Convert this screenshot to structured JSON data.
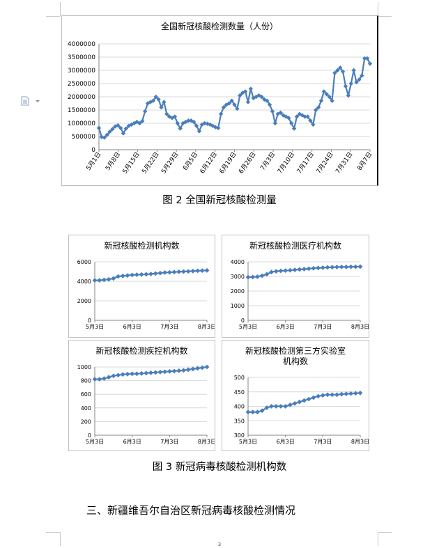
{
  "figure2": {
    "caption": "图 2 全国新冠核酸检测量",
    "chart_data": {
      "type": "line",
      "title": "全国新冠核酸检测数量（人份）",
      "x_tick_labels": [
        "5月1日",
        "5月8日",
        "5月15日",
        "5月22日",
        "5月29日",
        "6月5日",
        "6月12日",
        "6月19日",
        "6月26日",
        "7月3日",
        "7月10日",
        "7月17日",
        "7月24日",
        "7月31日",
        "8月7日"
      ],
      "ylim": [
        0,
        4000000
      ],
      "y_ticks": [
        0,
        500000,
        1000000,
        1500000,
        2000000,
        2500000,
        3000000,
        3500000,
        4000000
      ],
      "color": "#4a7ebb",
      "series": [
        {
          "values": [
            820000,
            480000,
            460000,
            560000,
            680000,
            780000,
            880000,
            920000,
            820000,
            620000,
            800000,
            900000,
            950000,
            1000000,
            1050000,
            1000000,
            1080000,
            1450000,
            1750000,
            1800000,
            1850000,
            2000000,
            1900000,
            1600000,
            1800000,
            1350000,
            1250000,
            1200000,
            1250000,
            1000000,
            800000,
            1000000,
            1050000,
            1100000,
            1100000,
            1050000,
            900000,
            700000,
            950000,
            1000000,
            980000,
            950000,
            900000,
            850000,
            820000,
            1350000,
            1600000,
            1700000,
            1750000,
            1850000,
            1700000,
            1550000,
            2050000,
            2150000,
            2200000,
            1800000,
            2300000,
            1950000,
            2000000,
            2050000,
            2000000,
            1900000,
            1850000,
            1700000,
            1450000,
            1000000,
            1350000,
            1400000,
            1300000,
            1250000,
            1200000,
            1000000,
            800000,
            1250000,
            1350000,
            1300000,
            1250000,
            1250000,
            1100000,
            950000,
            1500000,
            1600000,
            1850000,
            2200000,
            2100000,
            2000000,
            1850000,
            2900000,
            3000000,
            3100000,
            2950000,
            2400000,
            2050000,
            2500000,
            3000000,
            2550000,
            2650000,
            2800000,
            3450000,
            3450000,
            3250000
          ]
        }
      ]
    }
  },
  "figure3": {
    "caption": "图 3 新冠病毒核酸检测机构数",
    "x_tick_labels": [
      "5月3日",
      "6月3日",
      "7月3日",
      "8月3日"
    ],
    "charts": [
      {
        "type": "line",
        "title": "新冠核酸检测机构数",
        "ylim": [
          0,
          6000
        ],
        "y_ticks": [
          0,
          2000,
          4000,
          6000
        ],
        "series": [
          {
            "values": [
              4100,
              4100,
              4150,
              4200,
              4300,
              4500,
              4550,
              4600,
              4650,
              4680,
              4700,
              4720,
              4750,
              4800,
              4850,
              4900,
              4920,
              4950,
              4980,
              5000,
              5020,
              5050,
              5080,
              5100,
              5120
            ]
          }
        ]
      },
      {
        "type": "line",
        "title": "新冠核酸检测医疗机构数",
        "ylim": [
          0,
          4000
        ],
        "y_ticks": [
          0,
          1000,
          2000,
          3000,
          4000
        ],
        "series": [
          {
            "values": [
              2950,
              2960,
              2980,
              3050,
              3150,
              3300,
              3350,
              3380,
              3400,
              3420,
              3450,
              3480,
              3500,
              3530,
              3560,
              3580,
              3600,
              3620,
              3630,
              3640,
              3650,
              3650,
              3660,
              3660,
              3670
            ]
          }
        ]
      },
      {
        "type": "line",
        "title": "新冠核酸检测疾控机构数",
        "ylim": [
          0,
          1000
        ],
        "y_ticks": [
          0,
          200,
          400,
          600,
          800,
          1000
        ],
        "series": [
          {
            "values": [
              820,
              820,
              830,
              850,
              870,
              880,
              890,
              895,
              900,
              900,
              905,
              910,
              915,
              920,
              925,
              930,
              935,
              940,
              945,
              950,
              960,
              970,
              980,
              990,
              1000
            ]
          }
        ]
      },
      {
        "type": "line",
        "title": "新冠核酸检测第三方实验室机构数",
        "title_lines": [
          "新冠核酸检测第三方实验室",
          "机构数"
        ],
        "ylim": [
          300,
          500
        ],
        "y_ticks": [
          300,
          350,
          400,
          450,
          500
        ],
        "series": [
          {
            "values": [
              380,
              380,
              380,
              385,
              395,
              400,
              400,
              400,
              400,
              405,
              410,
              415,
              420,
              425,
              430,
              435,
              438,
              440,
              440,
              440,
              442,
              443,
              444,
              445,
              446
            ]
          }
        ]
      }
    ]
  },
  "section_heading": "三、新疆维吾尔自治区新冠病毒核酸检测情况",
  "page_number": "3"
}
